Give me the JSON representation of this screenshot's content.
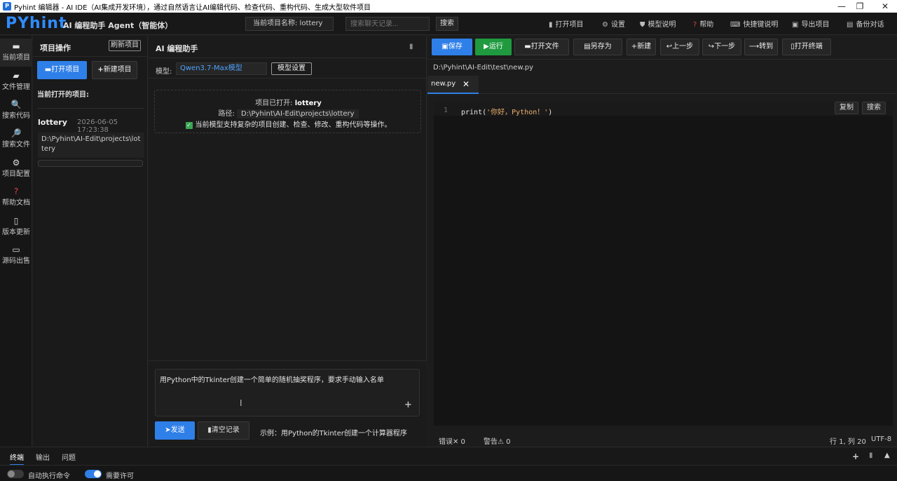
{
  "window": {
    "title": "Pyhint 编辑器 - AI IDE（AI集成开发环境），通过自然语言让AI编辑代码、检查代码、重构代码、生成大型软件项目",
    "minimize": "—",
    "restore": "❐",
    "close": "✕",
    "logo_letter": "P"
  },
  "header": {
    "brand": "PYhint",
    "subtitle": "AI 编程助手 Agent（智能体）",
    "project_name": "当前项目名称: lottery",
    "chat_search_placeholder": "搜索聊天记录...",
    "search_button": "搜索",
    "menu": [
      {
        "icon": "▮",
        "label": "打开项目"
      },
      {
        "icon": "⚙",
        "label": "设置"
      },
      {
        "icon": "⛊",
        "label": "模型说明"
      },
      {
        "icon": "?",
        "label": "帮助"
      },
      {
        "icon": "⌨",
        "label": "快捷键说明"
      },
      {
        "icon": "▣",
        "label": "导出项目"
      },
      {
        "icon": "▤",
        "label": "备份对话"
      }
    ]
  },
  "rail": {
    "items": [
      {
        "icon": "▬",
        "label": "当前项目"
      },
      {
        "icon": "▰",
        "label": "文件管理"
      },
      {
        "icon": "🔍",
        "label": "搜索代码"
      },
      {
        "icon": "🔎",
        "label": "搜索文件"
      },
      {
        "icon": "⚙",
        "label": "项目配置"
      },
      {
        "icon": "?",
        "label": "帮助文档"
      },
      {
        "icon": "▯",
        "label": "版本更新"
      },
      {
        "icon": "▭",
        "label": "源码出售"
      }
    ]
  },
  "project_panel": {
    "title": "项目操作",
    "refresh": "刷新项目",
    "open_button": "打开项目",
    "new_button": "新建项目",
    "current_label": "当前打开的项目:",
    "project": {
      "name": "lottery",
      "date": "2026-06-05 17:23:38",
      "path": "D:\\Pyhint\\AI-Edit\\projects\\lottery"
    }
  },
  "ai_panel": {
    "title": "AI 编程助手",
    "trash_icon": "▮",
    "model_label": "模型:",
    "model_value": "Qwen3.7-Max模型",
    "model_settings": "模型设置",
    "info": {
      "opened_prefix": "项目已打开:",
      "opened_name": "lottery",
      "path_prefix": "路径:",
      "path": "D:\\Pyhint\\AI-Edit\\projects\\lottery",
      "support": "当前模型支持复杂的项目创建、检查、修改、重构代码等操作。",
      "check_glyph": "✓"
    },
    "input_text": "用Python中的Tkinter创建一个简单的随机抽奖程序，要求手动输入名单",
    "cursor_glyph": "I",
    "attach_glyph": "+",
    "send_button": "➤发送",
    "clear_button": "清空记录",
    "example": "示例：用Python的Tkinter创建一个计算器程序"
  },
  "editor": {
    "toolbar": [
      {
        "icon": "▣",
        "label": "保存"
      },
      {
        "icon": "▶",
        "label": "运行"
      },
      {
        "icon": "▬",
        "label": "打开文件"
      },
      {
        "icon": "▤",
        "label": "另存为"
      },
      {
        "icon": "+",
        "label": "新建"
      },
      {
        "icon": "↩",
        "label": "上一步"
      },
      {
        "icon": "↪",
        "label": "下一步"
      },
      {
        "icon": "⟶",
        "label": "转到"
      },
      {
        "icon": "▯",
        "label": "打开终端"
      }
    ],
    "file_path": "D:\\Pyhint\\AI-Edit\\test\\new.py",
    "tab_name": "new.py",
    "tab_close": "✕",
    "line_number": "1",
    "code_func": "print(",
    "code_string": "'你好，Python！'",
    "code_end": ")",
    "copy_button": "复制",
    "search_button": "搜索",
    "status": {
      "errors": "错误✕ 0",
      "warnings": "警告⚠ 0",
      "position": "行 1, 列 20",
      "encoding": "UTF-8"
    }
  },
  "bottom": {
    "tabs": [
      "终端",
      "输出",
      "问题"
    ],
    "icons": [
      "+",
      "▮",
      "▲"
    ],
    "auto_exec": "自动执行命令",
    "need_permission": "需要许可"
  },
  "colors": {
    "accent": "#2f7fe8",
    "run": "#1f9a3f",
    "brand": "#2f8cff"
  }
}
